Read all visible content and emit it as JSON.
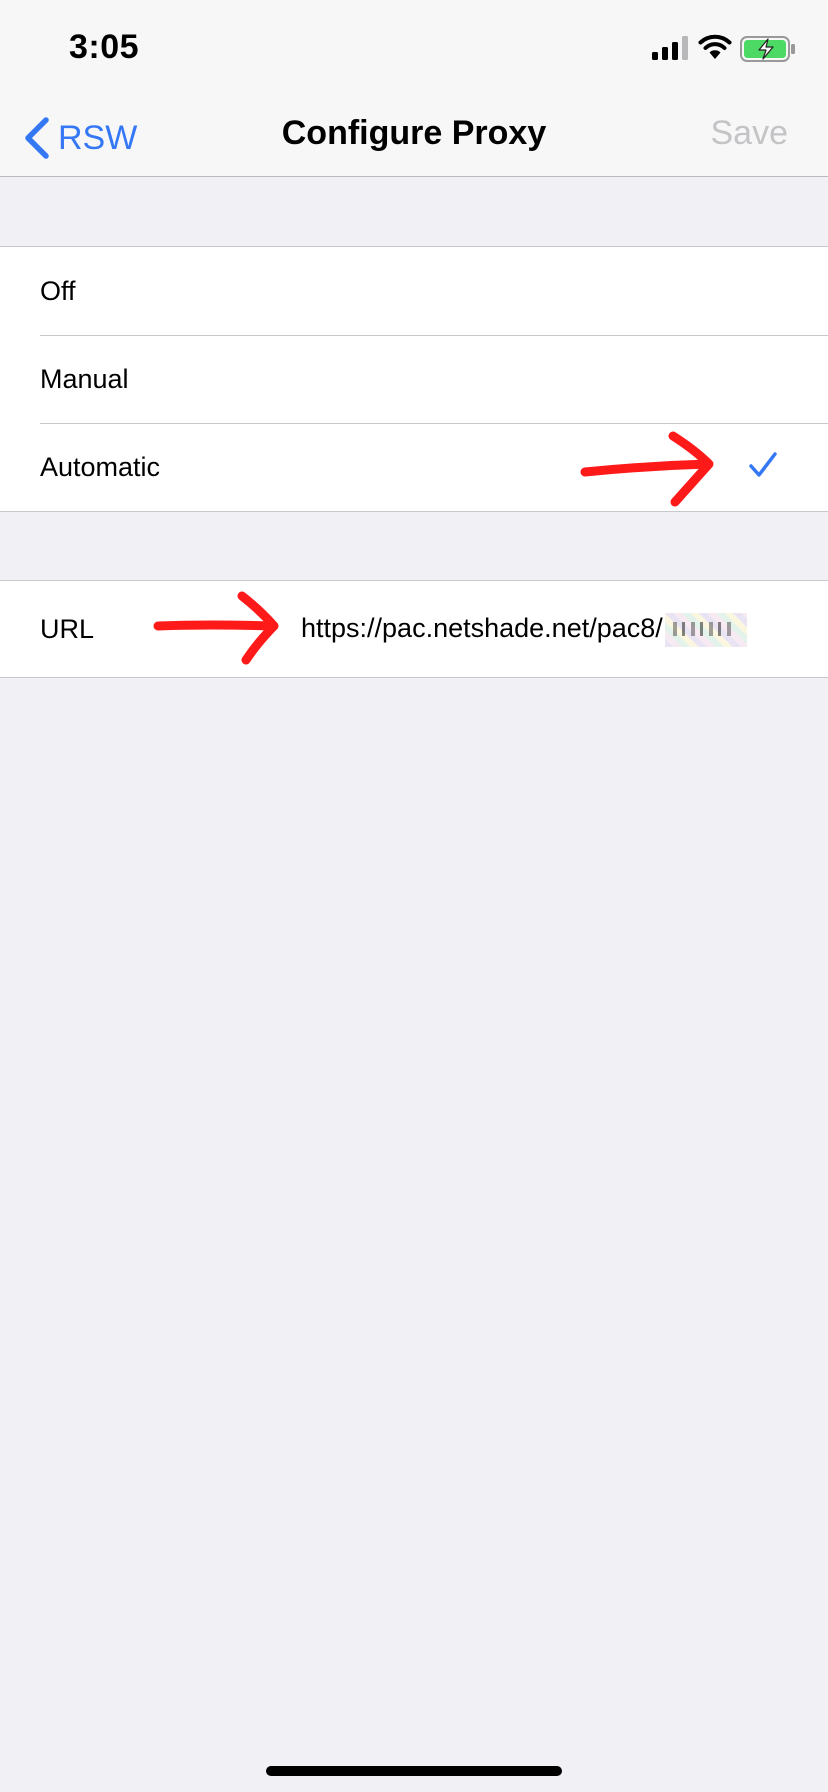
{
  "status_bar": {
    "time": "3:05",
    "icons": [
      "cellular-signal-icon",
      "wifi-icon",
      "battery-charging-icon"
    ]
  },
  "nav_bar": {
    "back_label": "RSW",
    "title": "Configure Proxy",
    "save_label": "Save"
  },
  "proxy_mode": {
    "options": [
      {
        "label": "Off",
        "selected": false
      },
      {
        "label": "Manual",
        "selected": false
      },
      {
        "label": "Automatic",
        "selected": true
      }
    ]
  },
  "url_field": {
    "label": "URL",
    "value": "https://pac.netshade.net/pac8/"
  },
  "colors": {
    "accent": "#3478f6",
    "disabled": "#c4c4c7",
    "annotation": "#ff0000",
    "background": "#f0f0f5"
  }
}
